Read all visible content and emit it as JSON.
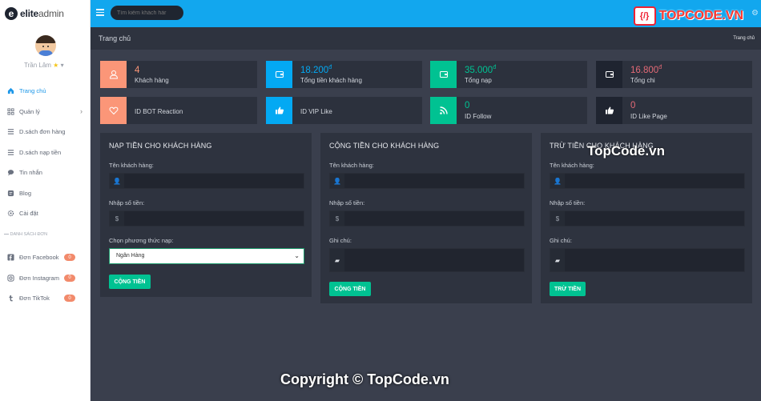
{
  "brand": {
    "mark": "e",
    "name_bold": "elite",
    "name_rest": "admin"
  },
  "user": {
    "name": "Trần Lâm",
    "star": "★",
    "caret": "▾"
  },
  "menu": [
    {
      "label": "Trang chủ",
      "icon": "home-icon",
      "active": true
    },
    {
      "label": "Quản lý",
      "icon": "grid-icon",
      "chevron": "›"
    },
    {
      "label": "D.sách đơn hàng",
      "icon": "list-icon"
    },
    {
      "label": "D.sách nạp tiền",
      "icon": "list-icon"
    },
    {
      "label": "Tin nhắn",
      "icon": "chat-icon"
    },
    {
      "label": "Blog",
      "icon": "blog-icon"
    },
    {
      "label": "Cài đặt",
      "icon": "gear-icon"
    }
  ],
  "section_label": "DANH SÁCH ĐƠN",
  "orders": [
    {
      "label": "Đơn Facebook",
      "icon": "facebook-icon",
      "count": "0"
    },
    {
      "label": "Đơn Instagram",
      "icon": "instagram-icon",
      "count": "0"
    },
    {
      "label": "Đơn TikTok",
      "icon": "tumblr-icon",
      "count": "0"
    }
  ],
  "topbar": {
    "search_placeholder": "Tìm kiếm khách hàr",
    "logo_badge": "{/}",
    "logo_text": "TOPCODE.VN"
  },
  "header": {
    "title": "Trang chủ",
    "breadcrumb": "Trang chủ"
  },
  "stats": [
    {
      "value": "4",
      "unit": "",
      "label": "Khách hàng",
      "icon": "user-icon",
      "color": "#fb9678",
      "text_color": "#fb9678"
    },
    {
      "value": "18.200",
      "unit": "đ",
      "label": "Tổng tiền khách hàng",
      "icon": "wallet-icon",
      "color": "#03a9f3",
      "text_color": "#03a9f3"
    },
    {
      "value": "35.000",
      "unit": "đ",
      "label": "Tổng nạp",
      "icon": "wallet-icon",
      "color": "#00c292",
      "text_color": "#00c292"
    },
    {
      "value": "16.800",
      "unit": "đ",
      "label": "Tổng chi",
      "icon": "wallet-icon",
      "color": "#1f2430",
      "text_color": "#e46a76"
    },
    {
      "value": "",
      "unit": "",
      "label": "ID BOT Reaction",
      "icon": "heart-icon",
      "color": "#fb9678",
      "text_color": "#fb9678"
    },
    {
      "value": "",
      "unit": "",
      "label": "ID VIP Like",
      "icon": "thumbs-up-icon",
      "color": "#03a9f3",
      "text_color": "#03a9f3"
    },
    {
      "value": "0",
      "unit": "",
      "label": "ID Follow",
      "icon": "rss-icon",
      "color": "#00c292",
      "text_color": "#00c292"
    },
    {
      "value": "0",
      "unit": "",
      "label": "ID Like Page",
      "icon": "thumbs-up-icon",
      "color": "#1f2430",
      "text_color": "#e46a76"
    }
  ],
  "panels": [
    {
      "title": "NẠP TIỀN CHO KHÁCH HÀNG",
      "customer_label": "Tên khách hàng:",
      "amount_label": "Nhập số tiền:",
      "method_label": "Chọn phương thức nạp:",
      "method_value": "Ngân Hàng",
      "button": "CỘNG TIỀN"
    },
    {
      "title": "CỘNG TIỀN CHO KHÁCH HÀNG",
      "customer_label": "Tên khách hàng:",
      "amount_label": "Nhập số tiền:",
      "note_label": "Ghi chú:",
      "button": "CỘNG TIỀN"
    },
    {
      "title": "TRỪ TIỀN CHO KHÁCH HÀNG",
      "customer_label": "Tên khách hàng:",
      "amount_label": "Nhập số tiền:",
      "note_label": "Ghi chú:",
      "button": "TRỪ TIỀN"
    }
  ],
  "field_icons": {
    "user": "👤",
    "money": "$",
    "note": "▰"
  },
  "watermarks": {
    "top": "TopCode.vn",
    "bottom": "Copyright © TopCode.vn"
  }
}
